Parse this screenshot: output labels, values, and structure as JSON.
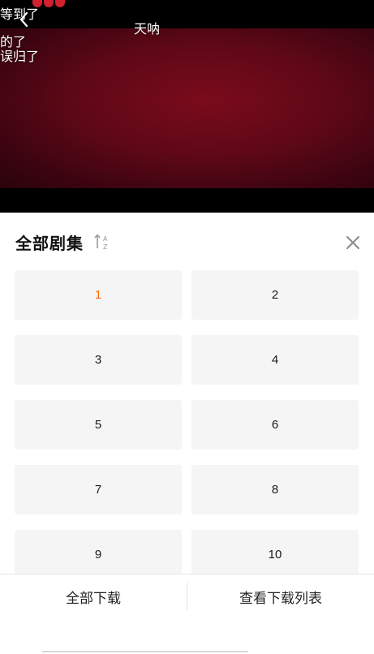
{
  "video": {
    "danmaku": [
      "等到了",
      "天呐",
      "的了",
      "误归了"
    ]
  },
  "panel": {
    "title": "全部剧集",
    "episodes": [
      {
        "label": "1",
        "active": true
      },
      {
        "label": "2",
        "active": false
      },
      {
        "label": "3",
        "active": false
      },
      {
        "label": "4",
        "active": false
      },
      {
        "label": "5",
        "active": false
      },
      {
        "label": "6",
        "active": false
      },
      {
        "label": "7",
        "active": false
      },
      {
        "label": "8",
        "active": false
      },
      {
        "label": "9",
        "active": false
      },
      {
        "label": "10",
        "active": false
      }
    ]
  },
  "actions": {
    "download_all": "全部下载",
    "view_downloads": "查看下载列表"
  },
  "colors": {
    "active_episode": "#ff6a00",
    "episode_bg": "#f5f5f5",
    "video_tint": "#6e0a1a"
  }
}
